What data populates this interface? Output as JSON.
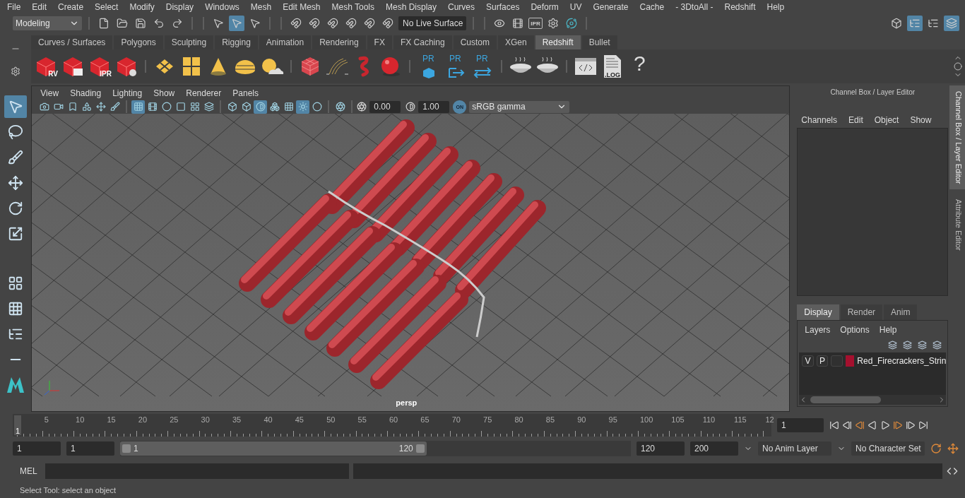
{
  "menu": [
    "File",
    "Edit",
    "Create",
    "Select",
    "Modify",
    "Display",
    "Windows",
    "Mesh",
    "Edit Mesh",
    "Mesh Tools",
    "Mesh Display",
    "Curves",
    "Surfaces",
    "Deform",
    "UV",
    "Generate",
    "Cache",
    "- 3DtoAll -",
    "Redshift",
    "Help"
  ],
  "toolbar": {
    "mode": "Modeling",
    "live_surface": "No Live Surface",
    "ipr_label": "IPR",
    "select_modes": [
      {
        "selected": false
      },
      {
        "selected": true
      },
      {
        "selected": false
      }
    ],
    "workspace_toggles": [
      {
        "selected": false
      },
      {
        "selected": true
      },
      {
        "selected": false
      },
      {
        "selected": true
      }
    ]
  },
  "shelf": {
    "tabs": [
      {
        "label": "Curves / Surfaces",
        "selected": false
      },
      {
        "label": "Polygons",
        "selected": false
      },
      {
        "label": "Sculpting",
        "selected": false
      },
      {
        "label": "Rigging",
        "selected": false
      },
      {
        "label": "Animation",
        "selected": false
      },
      {
        "label": "Rendering",
        "selected": false
      },
      {
        "label": "FX",
        "selected": false
      },
      {
        "label": "FX Caching",
        "selected": false
      },
      {
        "label": "Custom",
        "selected": false
      },
      {
        "label": "XGen",
        "selected": false
      },
      {
        "label": "Redshift",
        "selected": true
      },
      {
        "label": "Bullet",
        "selected": false
      }
    ],
    "items": [
      {
        "kind": "rs-cube",
        "label": "RV"
      },
      {
        "kind": "rs-clapper"
      },
      {
        "kind": "rs-cube",
        "label": "IPR"
      },
      {
        "kind": "rs-gear"
      },
      {
        "kind": "sep"
      },
      {
        "kind": "diamond"
      },
      {
        "kind": "grid"
      },
      {
        "kind": "cone"
      },
      {
        "kind": "dome"
      },
      {
        "kind": "sun"
      },
      {
        "kind": "sep"
      },
      {
        "kind": "redcube"
      },
      {
        "kind": "strands"
      },
      {
        "kind": "worm"
      },
      {
        "kind": "ball"
      },
      {
        "kind": "sep"
      },
      {
        "kind": "pr-box",
        "label": "PR"
      },
      {
        "kind": "pr-export",
        "label": "PR"
      },
      {
        "kind": "pr-swap",
        "label": "PR"
      },
      {
        "kind": "sep"
      },
      {
        "kind": "pie"
      },
      {
        "kind": "pie"
      },
      {
        "kind": "sep"
      },
      {
        "kind": "code"
      },
      {
        "kind": "log",
        "label": ".LOG"
      },
      {
        "kind": "help",
        "label": "?"
      }
    ]
  },
  "tools": [
    {
      "selected": true
    },
    {
      "selected": false
    },
    {
      "selected": false
    },
    {
      "selected": false
    },
    {
      "selected": false
    },
    {
      "selected": false
    }
  ],
  "viewport": {
    "menu": [
      "View",
      "Shading",
      "Lighting",
      "Show",
      "Renderer",
      "Panels"
    ],
    "toggles": [
      {
        "selected": false
      },
      {
        "selected": false
      },
      {
        "selected": false
      },
      {
        "selected": false
      },
      {
        "selected": false
      },
      {
        "selected": false
      },
      {
        "selected": true
      },
      {
        "selected": false
      },
      {
        "selected": false
      },
      {
        "selected": false
      },
      {
        "selected": false
      },
      {
        "selected": false
      },
      {
        "selected": false
      },
      {
        "selected": false
      },
      {
        "selected": true
      },
      {
        "selected": false
      },
      {
        "selected": false
      },
      {
        "selected": true
      },
      {
        "selected": false
      },
      {
        "selected": false
      }
    ],
    "exposure": "0.00",
    "gamma": "1.00",
    "color_mgmt": "ON",
    "color_space": "sRGB gamma",
    "camera": "persp"
  },
  "channel_box": {
    "title": "Channel Box / Layer Editor",
    "menu": [
      "Channels",
      "Edit",
      "Object",
      "Show"
    ]
  },
  "layer_editor": {
    "tabs": [
      {
        "label": "Display",
        "selected": true
      },
      {
        "label": "Render",
        "selected": false
      },
      {
        "label": "Anim",
        "selected": false
      }
    ],
    "menu": [
      "Layers",
      "Options",
      "Help"
    ],
    "layers": [
      {
        "visible": "V",
        "playback": "P",
        "color": "#a5102e",
        "name": "Red_Firecrackers_Strin"
      }
    ]
  },
  "side_tabs": [
    {
      "label": "Channel Box / Layer Editor",
      "selected": true
    },
    {
      "label": "Attribute Editor",
      "selected": false
    }
  ],
  "timeline": {
    "start_mark": "1",
    "frames": [
      "5",
      "10",
      "15",
      "20",
      "25",
      "30",
      "35",
      "40",
      "45",
      "50",
      "55",
      "60",
      "65",
      "70",
      "75",
      "80",
      "85",
      "90",
      "95",
      "100",
      "105",
      "110",
      "115",
      "12"
    ],
    "current_frame": "1",
    "level": 0
  },
  "range": {
    "start": "1",
    "playback_start": "1",
    "slider_start": "1",
    "slider_end": "120",
    "playback_end": "120",
    "end": "200",
    "anim_layer": "No Anim Layer",
    "character_set": "No Character Set",
    "level": 0.6
  },
  "command_line": {
    "label": "MEL"
  },
  "help_line": "Select Tool: select an object"
}
